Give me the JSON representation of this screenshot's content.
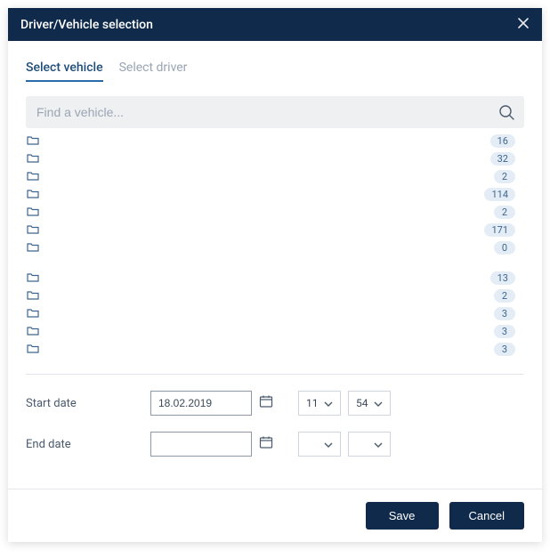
{
  "dialog": {
    "title": "Driver/Vehicle selection"
  },
  "tabs": {
    "vehicle": "Select vehicle",
    "driver": "Select driver"
  },
  "search": {
    "placeholder": "Find a vehicle..."
  },
  "folders": {
    "group1": [
      {
        "count": 16
      },
      {
        "count": 32
      },
      {
        "count": 2
      },
      {
        "count": 114
      },
      {
        "count": 2
      },
      {
        "count": 171
      },
      {
        "count": 0
      }
    ],
    "group2": [
      {
        "count": 13
      },
      {
        "count": 2
      },
      {
        "count": 3
      },
      {
        "count": 3
      },
      {
        "count": 3
      }
    ]
  },
  "dates": {
    "start_label": "Start date",
    "start_value": "18.02.2019",
    "start_hour": "11",
    "start_minute": "54",
    "end_label": "End date",
    "end_value": "",
    "end_hour": "",
    "end_minute": ""
  },
  "buttons": {
    "save": "Save",
    "cancel": "Cancel"
  }
}
